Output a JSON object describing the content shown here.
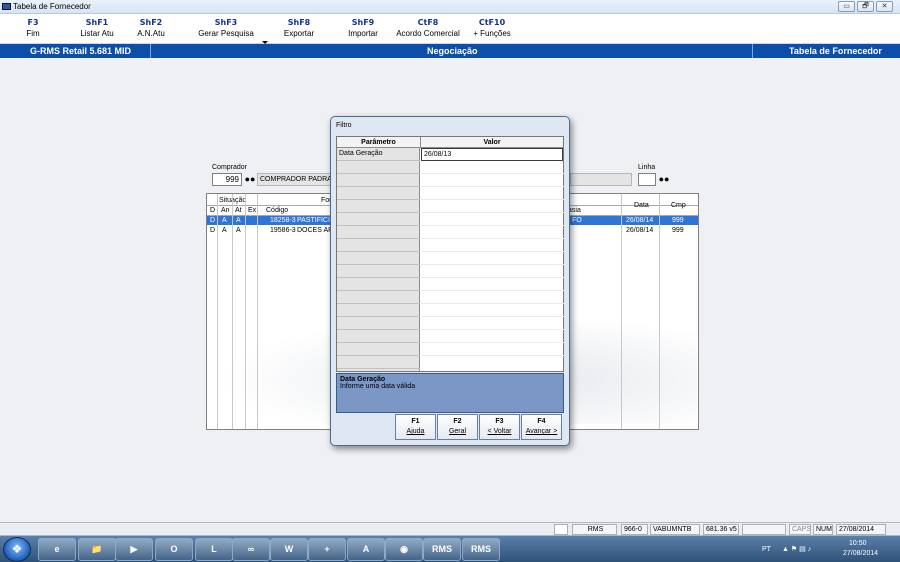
{
  "window": {
    "title": "Tabela de Fornecedor",
    "buttons": [
      "▭",
      "🗗",
      "✕"
    ]
  },
  "fkeys": [
    {
      "key": "F3",
      "label": "Fim"
    },
    {
      "key": "ShF1",
      "label": "Listar Atu"
    },
    {
      "key": "ShF2",
      "label": "A.N.Atu"
    },
    {
      "key": "ShF3",
      "label": "Gerar Pesquisa"
    },
    {
      "key": "ShF8",
      "label": "Exportar"
    },
    {
      "key": "ShF9",
      "label": "Importar"
    },
    {
      "key": "CtF8",
      "label": "Acordo Comercial"
    },
    {
      "key": "CtF10",
      "label": "+ Funções"
    }
  ],
  "header": {
    "version": "G-RMS Retail 5.681 MID",
    "section": "Negociação",
    "screen": "Tabela de Fornecedor"
  },
  "form": {
    "comprador_label": "Comprador",
    "comprador_code": "999",
    "comprador_name": "COMPRADOR PADRAO",
    "linha_label": "Linha",
    "search_icon": "binoculars-icon"
  },
  "grid": {
    "group_situacao": "Situação",
    "group_fornecedor": "For",
    "headers": [
      "D",
      "An",
      "At",
      "Ex",
      "Código",
      "asia",
      "Data",
      "Cmp"
    ],
    "rows": [
      {
        "d": "D",
        "an": "A",
        "at": "A",
        "codigo": "18258-3",
        "nome": "PASTIFICI",
        "fantasia": "FO",
        "data": "26/08/14",
        "cmp": "999",
        "selected": true
      },
      {
        "d": "D",
        "an": "A",
        "at": "A",
        "codigo": "19586-3",
        "nome": "DOCES AR",
        "fantasia": "",
        "data": "26/08/14",
        "cmp": "999",
        "selected": false
      }
    ]
  },
  "dialog": {
    "title": "Filtro",
    "col_param": "Parâmetro",
    "col_valor": "Valor",
    "param_name": "Data Geração",
    "param_value": "26/08/13",
    "help_title": "Data Geração",
    "help_text": "Informe uma data válida",
    "buttons": [
      {
        "key": "F1",
        "label": "Ajuda"
      },
      {
        "key": "F2",
        "label": "Geral"
      },
      {
        "key": "F3",
        "label": "< Voltar"
      },
      {
        "key": "F4",
        "label": "Avançar >"
      }
    ]
  },
  "status": {
    "rms": "RMS",
    "code": "966-0",
    "host": "VABUMNTB",
    "version": "681.36 v5",
    "caps": "CAPS",
    "num": "NUM",
    "date": "27/08/2014"
  },
  "taskbar": {
    "apps": [
      "e",
      "📁",
      "▶",
      "O",
      "L",
      "∞",
      "W",
      "+",
      "A",
      "◉",
      "RMS",
      "RMS"
    ],
    "lang": "PT",
    "time": "10:50",
    "date": "27/08/2014"
  }
}
